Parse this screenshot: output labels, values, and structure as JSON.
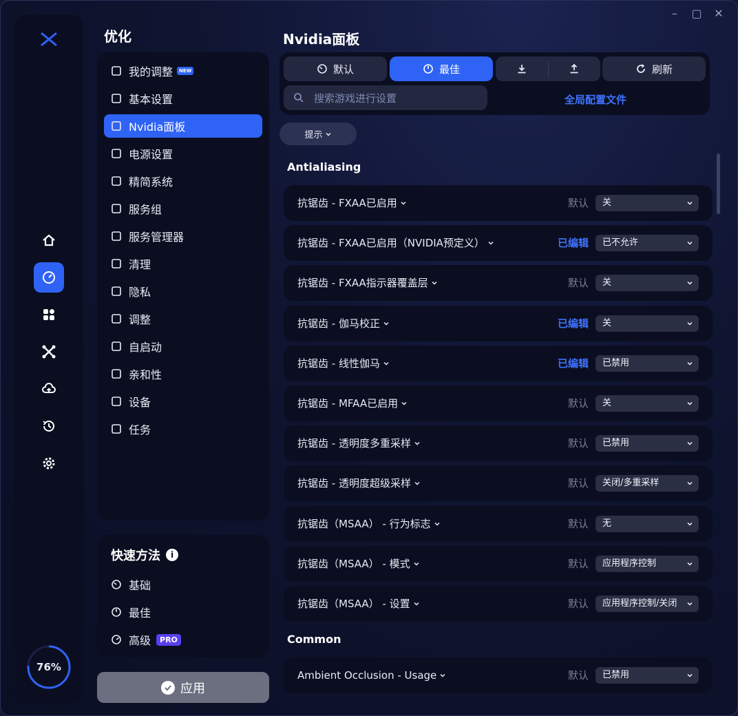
{
  "colors": {
    "accent": "#2f63f5",
    "link": "#3f72ff",
    "panel": "#0a0e20",
    "pro": "#5a3ff0"
  },
  "window_controls": [
    "minimize",
    "maximize",
    "close"
  ],
  "rail": {
    "icons": [
      "home-icon",
      "gauge-icon",
      "apps-icon",
      "tools-icon",
      "cloud-upload-icon",
      "history-icon",
      "gear-icon"
    ],
    "active_index": 1,
    "progress_label": "76%",
    "progress_value": 0.76
  },
  "sidebar": {
    "title": "优化",
    "items": [
      {
        "label": "我的调整",
        "icon": "list-plus-icon",
        "badge": "NEW"
      },
      {
        "label": "基本设置",
        "icon": "wrench-icon"
      },
      {
        "label": "Nvidia面板",
        "icon": "nvidia-icon",
        "active": true
      },
      {
        "label": "电源设置",
        "icon": "battery-icon"
      },
      {
        "label": "精简系统",
        "icon": "windows-icon"
      },
      {
        "label": "服务组",
        "icon": "gears-icon"
      },
      {
        "label": "服务管理器",
        "icon": "window-gear-icon"
      },
      {
        "label": "清理",
        "icon": "broom-icon"
      },
      {
        "label": "隐私",
        "icon": "spy-icon"
      },
      {
        "label": "调整",
        "icon": "grid-icon"
      },
      {
        "label": "自启动",
        "icon": "startup-icon"
      },
      {
        "label": "亲和性",
        "icon": "cpu-gear-icon"
      },
      {
        "label": "设备",
        "icon": "device-icon"
      },
      {
        "label": "任务",
        "icon": "task-check-icon"
      }
    ]
  },
  "quick": {
    "title": "快速方法",
    "info": "i",
    "items": [
      {
        "label": "基础",
        "icon": "gauge-low-icon"
      },
      {
        "label": "最佳",
        "icon": "gauge-mid-icon"
      },
      {
        "label": "高级",
        "icon": "gauge-high-icon",
        "badge": "PRO"
      }
    ]
  },
  "apply_label": "应用",
  "page": {
    "title": "Nvidia面板",
    "toolbar": {
      "default_label": "默认",
      "best_label": "最佳",
      "refresh_label": "刷新",
      "search_placeholder": "搜索游戏进行设置",
      "global_config": "全局配置文件"
    },
    "hint_label": "提示",
    "groups": [
      {
        "title": "Antialiasing",
        "rows": [
          {
            "label": "抗锯齿 - FXAA已启用",
            "state": "默认",
            "edited": false,
            "value": "关"
          },
          {
            "label": "抗锯齿 - FXAA已启用（NVIDIA预定义）",
            "state": "已编辑",
            "edited": true,
            "value": "已不允许"
          },
          {
            "label": "抗锯齿 - FXAA指示器覆盖层",
            "state": "默认",
            "edited": false,
            "value": "关"
          },
          {
            "label": "抗锯齿 - 伽马校正",
            "state": "已编辑",
            "edited": true,
            "value": "关"
          },
          {
            "label": "抗锯齿 - 线性伽马",
            "state": "已编辑",
            "edited": true,
            "value": "已禁用"
          },
          {
            "label": "抗锯齿 - MFAA已启用",
            "state": "默认",
            "edited": false,
            "value": "关"
          },
          {
            "label": "抗锯齿 - 透明度多重采样",
            "state": "默认",
            "edited": false,
            "value": "已禁用"
          },
          {
            "label": "抗锯齿 - 透明度超级采样",
            "state": "默认",
            "edited": false,
            "value": "关闭/多重采样"
          },
          {
            "label": "抗锯齿（MSAA） - 行为标志",
            "state": "默认",
            "edited": false,
            "value": "无"
          },
          {
            "label": "抗锯齿（MSAA） - 模式",
            "state": "默认",
            "edited": false,
            "value": "应用程序控制"
          },
          {
            "label": "抗锯齿（MSAA） - 设置",
            "state": "默认",
            "edited": false,
            "value": "应用程序控制/关闭"
          }
        ]
      },
      {
        "title": "Common",
        "rows": [
          {
            "label": "Ambient Occlusion  - Usage",
            "state": "默认",
            "edited": false,
            "value": "已禁用"
          }
        ]
      }
    ]
  }
}
